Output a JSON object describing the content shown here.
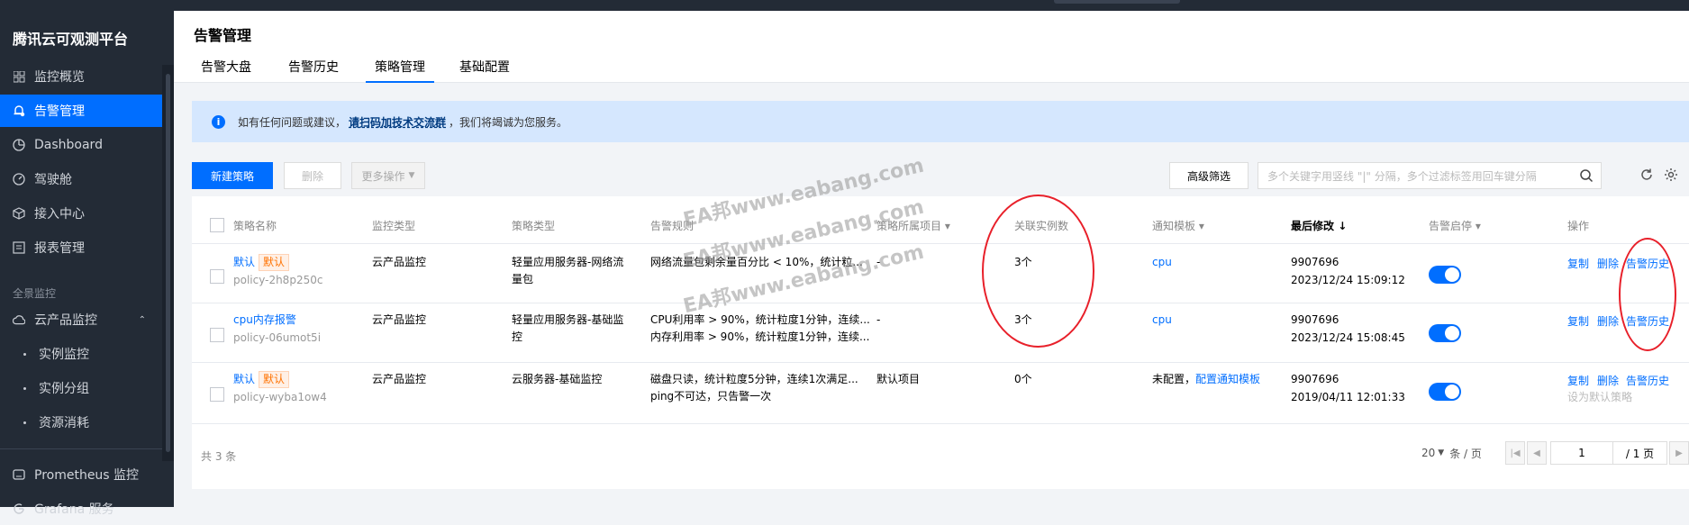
{
  "app": {
    "title": "腾讯云可观测平台"
  },
  "sidebar": {
    "items": [
      {
        "label": "监控概览",
        "icon": "grid-icon"
      },
      {
        "label": "告警管理",
        "icon": "alarm-icon"
      },
      {
        "label": "Dashboard",
        "icon": "dashboard-icon"
      },
      {
        "label": "驾驶舱",
        "icon": "gauge-icon"
      },
      {
        "label": "接入中心",
        "icon": "cube-icon"
      },
      {
        "label": "报表管理",
        "icon": "report-icon"
      }
    ],
    "section": "全景监控",
    "cloud_group": {
      "label": "云产品监控",
      "icon": "cloud-icon"
    },
    "sub_items": [
      "实例监控",
      "实例分组",
      "资源消耗"
    ],
    "bottom_items": [
      {
        "label": "Prometheus 监控",
        "icon": "prometheus-icon"
      },
      {
        "label": "Grafana 服务",
        "icon": "grafana-icon"
      }
    ]
  },
  "header": {
    "title": "告警管理",
    "tabs": [
      "告警大盘",
      "告警历史",
      "策略管理",
      "基础配置"
    ],
    "active_tab": "策略管理"
  },
  "notice": {
    "prefix": "如有任何问题或建议，",
    "link": "请扫码加技术交流群",
    "suffix": "，我们将竭诚为您服务。"
  },
  "toolbar": {
    "new_label": "新建策略",
    "delete_label": "删除",
    "more_label": "更多操作",
    "advanced_filter": "高级筛选",
    "search_placeholder": "多个关键字用竖线 \"|\" 分隔，多个过滤标签用回车键分隔"
  },
  "table": {
    "columns": [
      "策略名称",
      "监控类型",
      "策略类型",
      "告警规则",
      "策略所属项目",
      "关联实例数",
      "通知模板",
      "最后修改",
      "告警启停",
      "操作"
    ],
    "rows": [
      {
        "name": "默认",
        "tag": "默认",
        "id": "policy-2h8p250c",
        "monitor_type": "云产品监控",
        "policy_type": [
          "轻量应用服务器-网络流",
          "量包"
        ],
        "rules": [
          "网络流量包剩余量百分比 < 10%，统计粒..."
        ],
        "project": "-",
        "instances": "3个",
        "template": "cpu",
        "template_extra": "",
        "modifier": "9907696",
        "modified": "2023/12/24 15:09:12",
        "enabled": true,
        "ops": [
          "复制",
          "删除",
          "告警历史"
        ],
        "note": ""
      },
      {
        "name": "cpu内存报警",
        "tag": "",
        "id": "policy-06umot5i",
        "monitor_type": "云产品监控",
        "policy_type": [
          "轻量应用服务器-基础监",
          "控"
        ],
        "rules": [
          "CPU利用率 > 90%，统计粒度1分钟，连续...",
          "内存利用率 > 90%，统计粒度1分钟，连续..."
        ],
        "project": "-",
        "instances": "3个",
        "template": "cpu",
        "template_extra": "",
        "modifier": "9907696",
        "modified": "2023/12/24 15:08:45",
        "enabled": true,
        "ops": [
          "复制",
          "删除",
          "告警历史"
        ],
        "note": ""
      },
      {
        "name": "默认",
        "tag": "默认",
        "id": "policy-wyba1ow4",
        "monitor_type": "云产品监控",
        "policy_type": [
          "云服务器-基础监控",
          ""
        ],
        "rules": [
          "磁盘只读，统计粒度5分钟，连续1次满足...",
          "ping不可达，只告警一次"
        ],
        "project": "默认项目",
        "instances": "0个",
        "template": "未配置，",
        "template_extra": "配置通知模板",
        "modifier": "9907696",
        "modified": "2019/04/11 12:01:33",
        "enabled": true,
        "ops": [
          "复制",
          "删除",
          "告警历史"
        ],
        "note": "设为默认策略"
      }
    ],
    "total": "共 3 条",
    "page_size": "20",
    "page_size_unit": "条 / 页",
    "page": "1",
    "page_total": "/ 1 页"
  },
  "watermark": "EA邦www.eabang.com",
  "colors": {
    "brand": "#006eff",
    "sidebar": "#232b36",
    "annotation": "#e8202a"
  }
}
